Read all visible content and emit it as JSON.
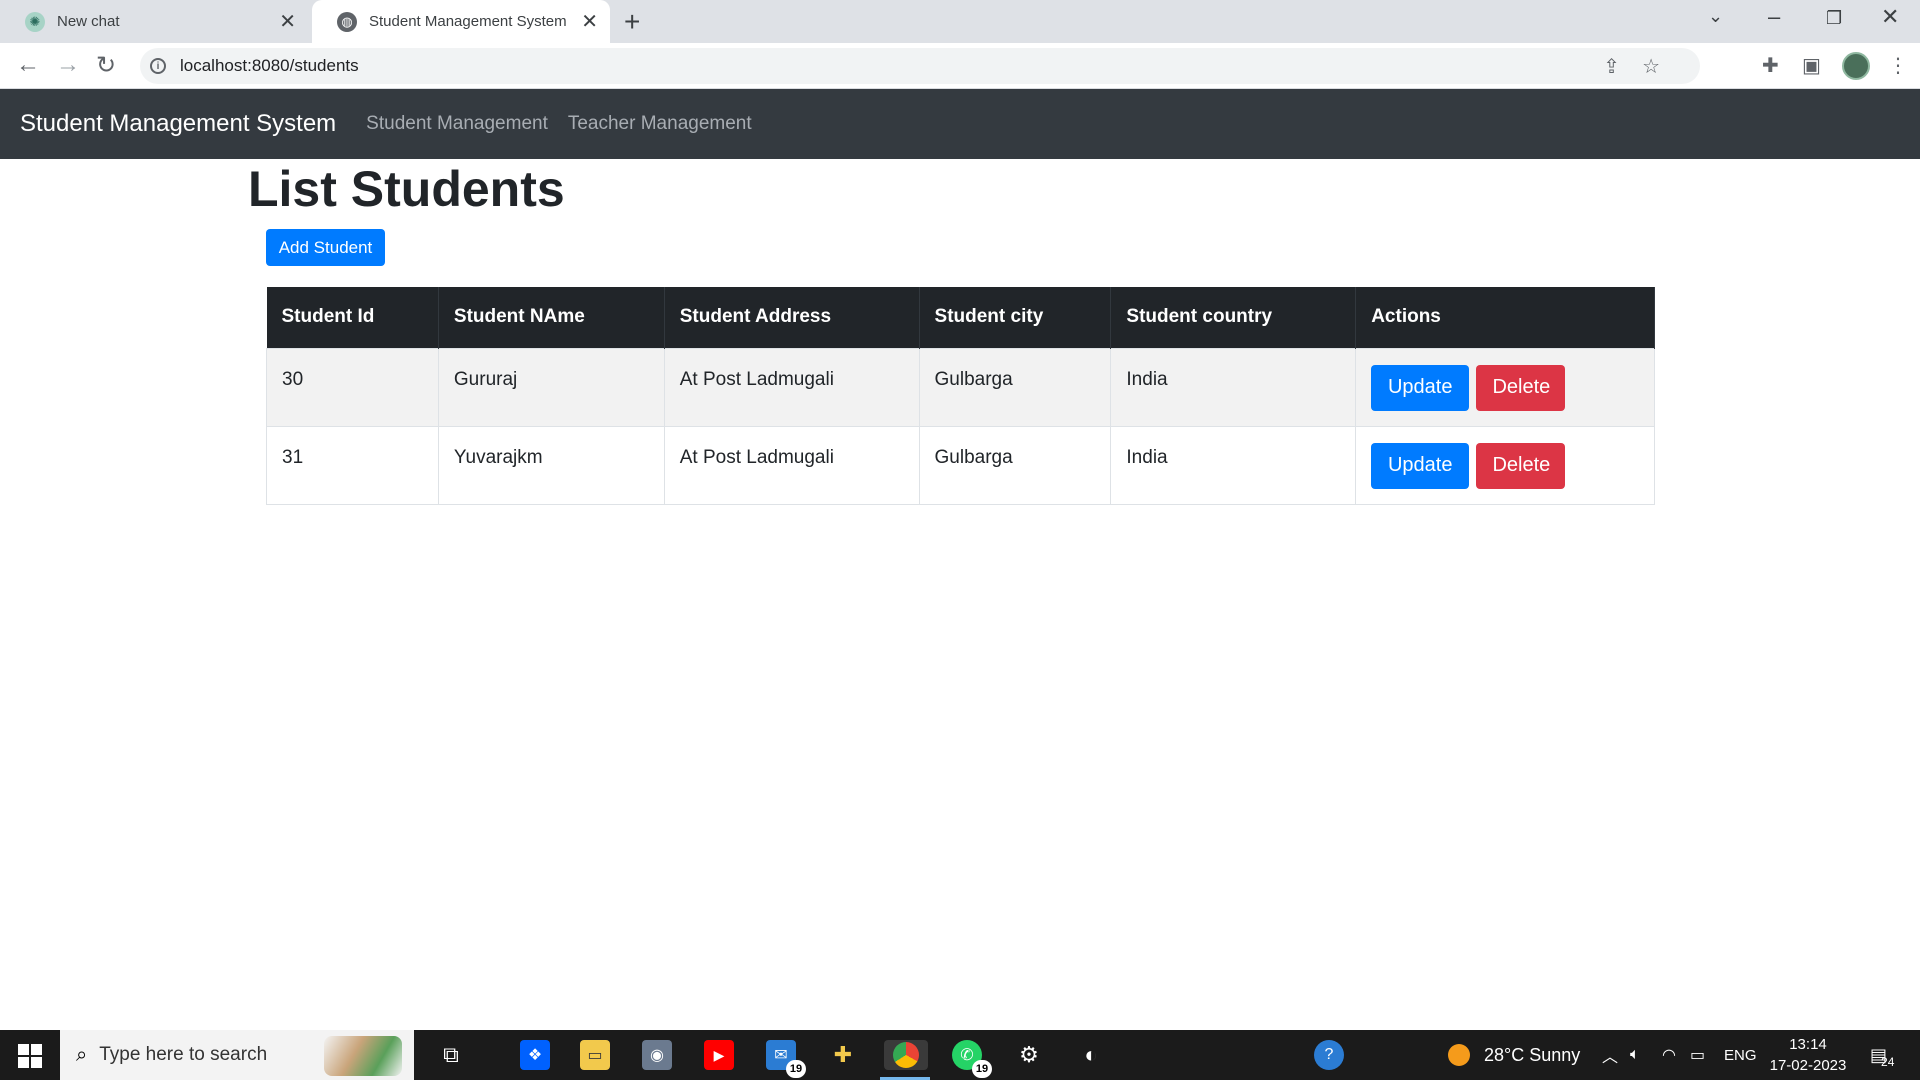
{
  "browser": {
    "tabs": [
      {
        "title": "New chat",
        "icon": "chatgpt-icon"
      },
      {
        "title": "Student Management System",
        "icon": "globe-icon"
      }
    ],
    "url": "localhost:8080/students"
  },
  "navbar": {
    "brand": "Student Management System",
    "links": [
      "Student Management",
      "Teacher Management"
    ]
  },
  "page": {
    "title": "List Students",
    "add_button": "Add Student"
  },
  "table": {
    "headers": [
      "Student Id",
      "Student NAme",
      "Student Address",
      "Student city",
      "Student country",
      "Actions"
    ],
    "rows": [
      {
        "id": "30",
        "name": "Gururaj",
        "address": "At Post Ladmugali",
        "city": "Gulbarga",
        "country": "India"
      },
      {
        "id": "31",
        "name": "Yuvarajkm",
        "address": "At Post Ladmugali",
        "city": "Gulbarga",
        "country": "India"
      }
    ],
    "update_label": "Update",
    "delete_label": "Delete"
  },
  "taskbar": {
    "search_placeholder": "Type here to search",
    "mail_badge": "19",
    "whatsapp_badge": "19",
    "weather": "28°C  Sunny",
    "language": "ENG",
    "time": "13:14",
    "date": "17-02-2023",
    "notifications": "24"
  },
  "colors": {
    "primary": "#007bff",
    "danger": "#dc3545",
    "navbar": "#343a40",
    "table_header": "#212529"
  }
}
